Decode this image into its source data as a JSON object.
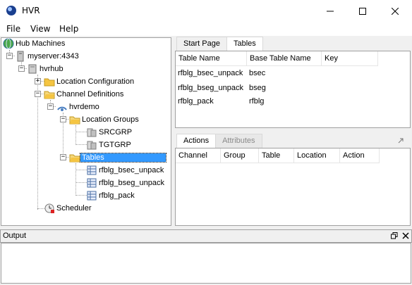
{
  "window": {
    "title": "HVR"
  },
  "menu": {
    "file": "File",
    "view": "View",
    "help": "Help"
  },
  "tree": {
    "hub_machines": "Hub Machines",
    "server": "myserver:4343",
    "hub": "hvrhub",
    "location_configuration": "Location Configuration",
    "channel_definitions": "Channel Definitions",
    "channel": "hvrdemo",
    "location_groups": "Location Groups",
    "group_1": "SRCGRP",
    "group_2": "TGTGRP",
    "tables": "Tables",
    "table_1": "rfblg_bsec_unpack",
    "table_2": "rfblg_bseg_unpack",
    "table_3": "rfblg_pack",
    "scheduler": "Scheduler"
  },
  "top_tabs": {
    "start_page": "Start Page",
    "tables": "Tables"
  },
  "tables_grid": {
    "headers": [
      "Table Name",
      "Base Table Name",
      "Key"
    ],
    "rows": [
      [
        "rfblg_bsec_unpack",
        "bsec",
        ""
      ],
      [
        "rfblg_bseg_unpack",
        "bseg",
        ""
      ],
      [
        "rfblg_pack",
        "rfblg",
        ""
      ]
    ]
  },
  "bottom_tabs": {
    "actions": "Actions",
    "attributes": "Attributes"
  },
  "actions_grid": {
    "headers": [
      "Channel",
      "Group",
      "Table",
      "Location",
      "Action"
    ]
  },
  "output": {
    "title": "Output"
  },
  "colors": {
    "selection": "#3399ff",
    "folder": "#f5c542"
  }
}
